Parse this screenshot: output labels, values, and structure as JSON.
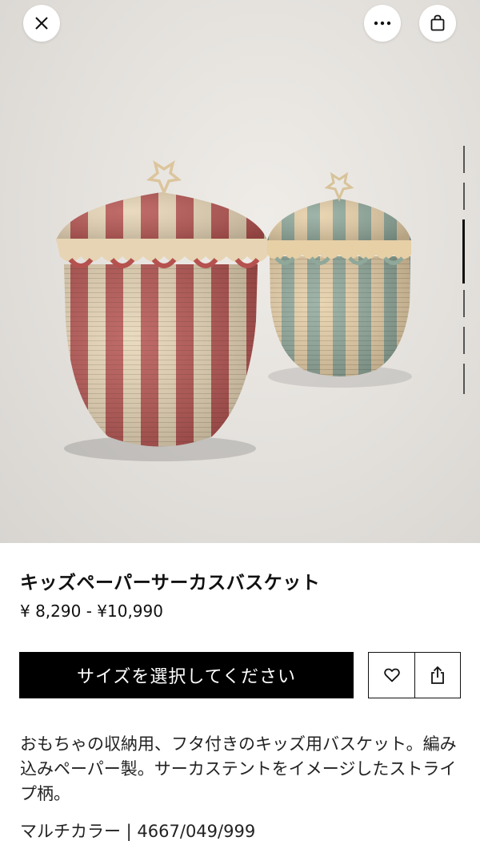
{
  "top_bar": {
    "close_icon": "close-icon",
    "more_icon": "more-icon",
    "bag_icon": "shopping-bag-icon"
  },
  "gallery": {
    "image_count": 8,
    "active_index": 2
  },
  "product": {
    "title": "キッズペーパーサーカスバスケット",
    "price": "¥ 8,290 - ¥10,990",
    "size_button_label": "サイズを選択してください",
    "description": "おもちゃの収納用、フタ付きのキッズ用バスケット。編み込みペーパー製。サーカステントをイメージしたストライプ柄。",
    "reference": "マルチカラー | 4667/049/999"
  },
  "actions": {
    "wishlist_icon": "heart-icon",
    "share_icon": "share-icon"
  },
  "colors": {
    "primary_button": "#000000",
    "basket_red": "#b5524f",
    "basket_green": "#8fa89a",
    "basket_cream": "#e6d4b4"
  }
}
